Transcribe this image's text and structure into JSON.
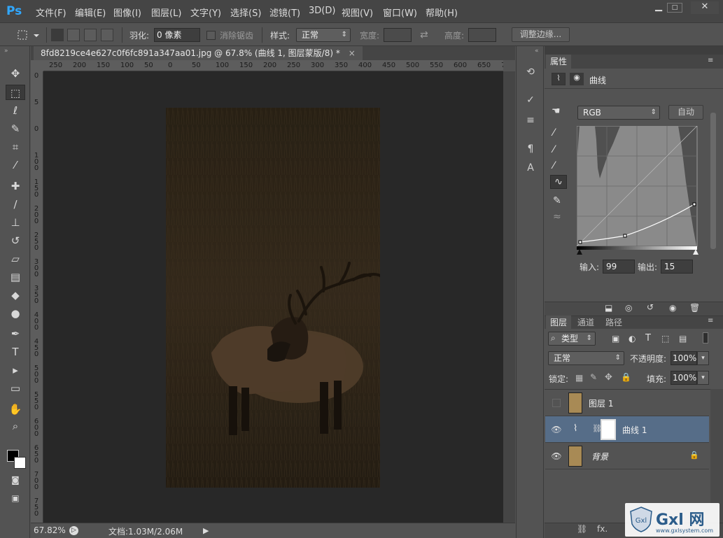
{
  "app": {
    "logo": "Ps"
  },
  "menu": [
    "文件(F)",
    "编辑(E)",
    "图像(I)",
    "图层(L)",
    "文字(Y)",
    "选择(S)",
    "滤镜(T)",
    "3D(D)",
    "视图(V)",
    "窗口(W)",
    "帮助(H)"
  ],
  "window_controls": {
    "minimize": "▁",
    "maximize": "□",
    "close": "✕"
  },
  "options": {
    "feather_label": "羽化:",
    "feather_value": "0 像素",
    "antialias_label": "消除锯齿",
    "style_label": "样式:",
    "style_value": "正常",
    "width_label": "宽度:",
    "height_label": "高度:",
    "refine_edge": "调整边缘..."
  },
  "document": {
    "tab_title": "8fd8219ce4e627c0f6fc891a347aa01.jpg @ 67.8% (曲线 1, 图层蒙版/8) *",
    "close": "×",
    "ruler_h": [
      "250",
      "200",
      "150",
      "100",
      "50",
      "0",
      "50",
      "100",
      "150",
      "200",
      "250",
      "300",
      "350",
      "400",
      "450",
      "500",
      "550",
      "600",
      "650",
      "7"
    ],
    "ruler_v": [
      "0",
      "5",
      "0",
      "1 0 0",
      "1 5 0",
      "2 0 0",
      "2 5 0",
      "3 0 0",
      "3 5 0",
      "4 0 0",
      "4 5 0",
      "5 0 0",
      "5 5 0",
      "6 0 0",
      "6 5 0",
      "7 0 0",
      "7 5 0"
    ],
    "zoom": "67.82%",
    "doc_size": "文档:1.03M/2.06M"
  },
  "properties": {
    "tab": "属性",
    "adjustment_title": "曲线",
    "channel": "RGB",
    "auto_button": "自动",
    "input_label": "输入:",
    "input_value": "99",
    "output_label": "输出:",
    "output_value": "15"
  },
  "layers_panel": {
    "tabs": [
      "图层",
      "通道",
      "路径"
    ],
    "filter_kind": "类型",
    "blend_mode": "正常",
    "opacity_label": "不透明度:",
    "opacity_value": "100%",
    "lock_label": "锁定:",
    "fill_label": "填充:",
    "fill_value": "100%",
    "layers": [
      {
        "name": "图层 1",
        "visible": false
      },
      {
        "name": "曲线 1",
        "visible": true
      },
      {
        "name": "背景",
        "visible": true
      }
    ],
    "footer_fx": "fx."
  },
  "watermark": {
    "brand": "Gxl 网",
    "url": "www.gxlsystem.com"
  }
}
